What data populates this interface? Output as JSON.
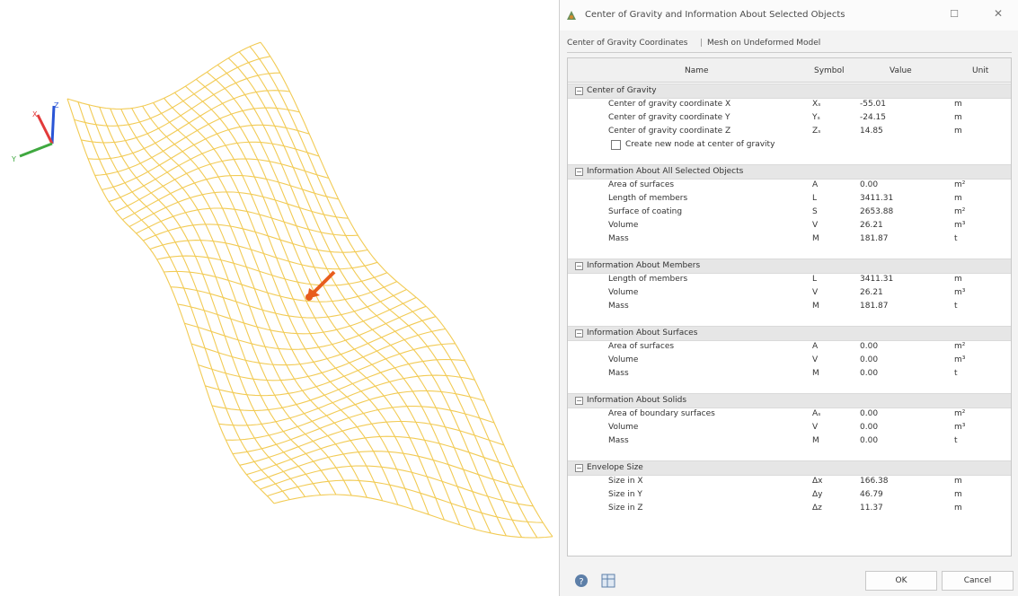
{
  "dialog": {
    "title": "Center of Gravity and Information About Selected Objects",
    "tabs": [
      "Center of Gravity Coordinates",
      "Mesh on Undeformed Model"
    ],
    "tab_separator": "|",
    "controls": {
      "maximize": "☐",
      "close": "✕"
    }
  },
  "table": {
    "headers": {
      "name": "Name",
      "symbol": "Symbol",
      "value": "Value",
      "unit": "Unit"
    },
    "groups": [
      {
        "title": "Center of Gravity",
        "rows": [
          {
            "name": "Center of gravity coordinate X",
            "symbol": "Xₛ",
            "value": "-55.01",
            "unit": "m"
          },
          {
            "name": "Center of gravity coordinate Y",
            "symbol": "Yₛ",
            "value": "-24.15",
            "unit": "m"
          },
          {
            "name": "Center of gravity coordinate Z",
            "symbol": "Zₛ",
            "value": "14.85",
            "unit": "m"
          }
        ],
        "checkbox": {
          "label": "Create new node at center of gravity",
          "checked": false
        }
      },
      {
        "title": "Information About All Selected Objects",
        "rows": [
          {
            "name": "Area of surfaces",
            "symbol": "A",
            "value": "0.00",
            "unit": "m²"
          },
          {
            "name": "Length of members",
            "symbol": "L",
            "value": "3411.31",
            "unit": "m"
          },
          {
            "name": "Surface of coating",
            "symbol": "S",
            "value": "2653.88",
            "unit": "m²"
          },
          {
            "name": "Volume",
            "symbol": "V",
            "value": "26.21",
            "unit": "m³"
          },
          {
            "name": "Mass",
            "symbol": "M",
            "value": "181.87",
            "unit": "t"
          }
        ]
      },
      {
        "title": "Information About Members",
        "rows": [
          {
            "name": "Length of members",
            "symbol": "L",
            "value": "3411.31",
            "unit": "m"
          },
          {
            "name": "Volume",
            "symbol": "V",
            "value": "26.21",
            "unit": "m³"
          },
          {
            "name": "Mass",
            "symbol": "M",
            "value": "181.87",
            "unit": "t"
          }
        ]
      },
      {
        "title": "Information About Surfaces",
        "rows": [
          {
            "name": "Area of surfaces",
            "symbol": "A",
            "value": "0.00",
            "unit": "m²"
          },
          {
            "name": "Volume",
            "symbol": "V",
            "value": "0.00",
            "unit": "m³"
          },
          {
            "name": "Mass",
            "symbol": "M",
            "value": "0.00",
            "unit": "t"
          }
        ]
      },
      {
        "title": "Information About Solids",
        "rows": [
          {
            "name": "Area of boundary surfaces",
            "symbol": "Aₛ",
            "value": "0.00",
            "unit": "m²"
          },
          {
            "name": "Volume",
            "symbol": "V",
            "value": "0.00",
            "unit": "m³"
          },
          {
            "name": "Mass",
            "symbol": "M",
            "value": "0.00",
            "unit": "t"
          }
        ]
      },
      {
        "title": "Envelope Size",
        "rows": [
          {
            "name": "Size in X",
            "symbol": "Δx",
            "value": "166.38",
            "unit": "m"
          },
          {
            "name": "Size in Y",
            "symbol": "Δy",
            "value": "46.79",
            "unit": "m"
          },
          {
            "name": "Size in Z",
            "symbol": "Δz",
            "value": "11.37",
            "unit": "m"
          }
        ]
      }
    ]
  },
  "buttons": {
    "ok": "OK",
    "cancel": "Cancel"
  },
  "axes": {
    "x": "X",
    "y": "Y",
    "z": "Z"
  },
  "colors": {
    "mesh": "#f2cb55",
    "cog_arrow": "#e85d1e",
    "axis_x": "#e23a3a",
    "axis_y": "#3fa83f",
    "axis_z": "#2a55d6"
  },
  "icons": [
    "center-of-gravity-icon",
    "help-icon",
    "table-export-icon"
  ]
}
